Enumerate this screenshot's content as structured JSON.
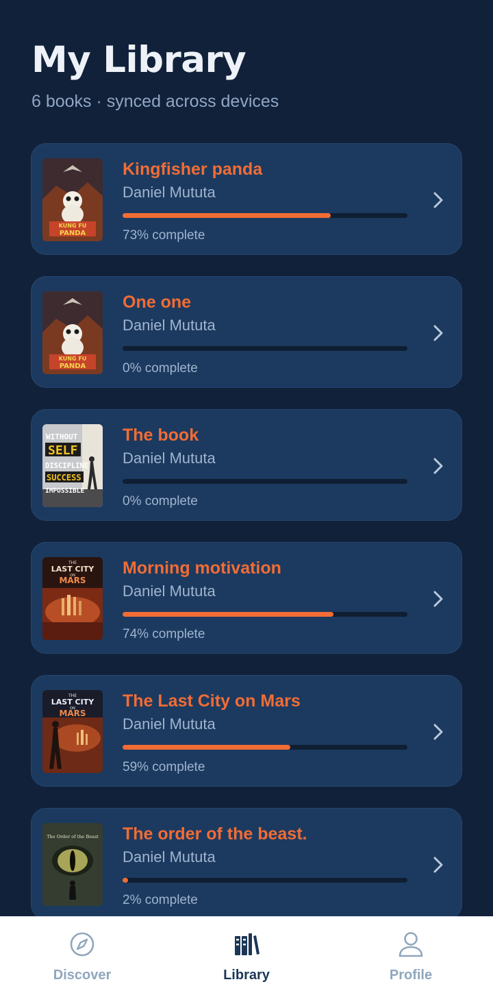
{
  "header": {
    "title": "My Library",
    "subtitle": "6 books · synced across devices"
  },
  "books": [
    {
      "title": "Kingfisher panda",
      "author": "Daniel Mututa",
      "progress": 0.73,
      "progress_text": "73% complete",
      "cover": "kung-fu-panda-cover",
      "cover_text": [
        "KUNG FU",
        "PANDA"
      ]
    },
    {
      "title": "One one",
      "author": "Daniel Mututa",
      "progress": 0.0,
      "progress_text": "0% complete",
      "cover": "kung-fu-panda-cover",
      "cover_text": [
        "KUNG FU",
        "PANDA"
      ]
    },
    {
      "title": "The book",
      "author": "Daniel Mututa",
      "progress": 0.0,
      "progress_text": "0% complete",
      "cover": "self-discipline-cover",
      "cover_text": [
        "WITHOUT",
        "SELF",
        "DISCIPLINE",
        "SUCCESS",
        "IMPOSSIBLE"
      ]
    },
    {
      "title": "Morning motivation",
      "author": "Daniel Mututa",
      "progress": 0.74,
      "progress_text": "74% complete",
      "cover": "last-city-mars-cover",
      "cover_text": [
        "THE",
        "LAST CITY",
        "ON",
        "MARS"
      ]
    },
    {
      "title": "The Last City on Mars",
      "author": "Daniel Mututa",
      "progress": 0.59,
      "progress_text": "59% complete",
      "cover": "last-city-mars-cover",
      "cover_text": [
        "THE",
        "LAST CITY",
        "ON",
        "MARS"
      ]
    },
    {
      "title": "The order of the beast.",
      "author": "Daniel Mututa",
      "progress": 0.02,
      "progress_text": "2% complete",
      "cover": "order-of-beast-cover",
      "cover_text": [
        "The Order of the Beast"
      ]
    }
  ],
  "bottom_nav": [
    {
      "label": "Discover",
      "icon": "compass-icon",
      "active": false
    },
    {
      "label": "Library",
      "icon": "library-icon",
      "active": true
    },
    {
      "label": "Profile",
      "icon": "user-icon",
      "active": false
    }
  ],
  "colors": {
    "background": "#11213a",
    "card": "#1c3a5f",
    "accent": "#f26c35",
    "nav_active": "#1c3656",
    "nav_inactive": "#8fa6bd"
  }
}
